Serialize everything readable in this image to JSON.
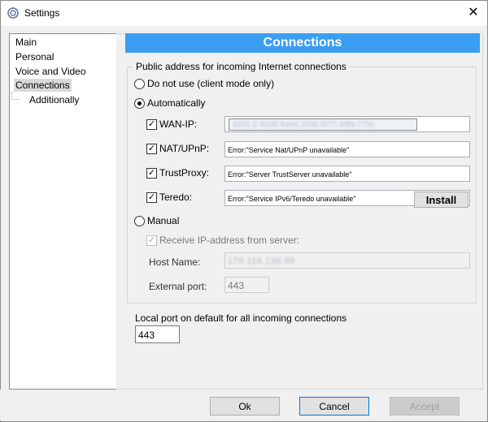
{
  "window": {
    "title": "Settings",
    "close_glyph": "✕",
    "icon": "settings-gear-icon"
  },
  "sidebar": {
    "items": [
      {
        "label": "Main"
      },
      {
        "label": "Personal"
      },
      {
        "label": "Voice and Video"
      },
      {
        "label": "Connections",
        "selected": true
      },
      {
        "label": "Additionally"
      }
    ]
  },
  "connections": {
    "header": "Connections",
    "public_address": {
      "legend": "Public address for incoming Internet connections",
      "do_not_use_label": "Do not use (client mode only)",
      "automatically_label": "Automatically",
      "automatically_selected": true,
      "wan_ip": {
        "label": "WAN-IP:",
        "checked": true,
        "value": "2001:0:9d38:6abd:2036:f477:4f8b:779c"
      },
      "nat_upnp": {
        "label": "NAT/UPnP:",
        "checked": true,
        "value": "Error:\"Service Nat/UPnP unavailable\""
      },
      "trust_proxy": {
        "label": "TrustProxy:",
        "checked": true,
        "value": "Error:\"Server TrustServer unavailable\""
      },
      "teredo": {
        "label": "Teredo:",
        "checked": true,
        "value": "Error:\"Service IPv6/Teredo unavailable\"",
        "install_label": "Install"
      },
      "manual_label": "Manual",
      "receive_ip_label": "Receive IP-address from server:",
      "receive_ip_checked": true,
      "host_name_label": "Host Name:",
      "host_name_value": "176.116.136.99",
      "external_port_label": "External port:",
      "external_port_value": "443"
    },
    "local_port": {
      "label": "Local port on default for all incoming connections",
      "value": "443"
    }
  },
  "buttons": {
    "ok": "Ok",
    "cancel": "Cancel",
    "accept": "Accept"
  },
  "colors": {
    "header_bg": "#3a9ef2",
    "selection_bg": "#d9d9d9"
  }
}
